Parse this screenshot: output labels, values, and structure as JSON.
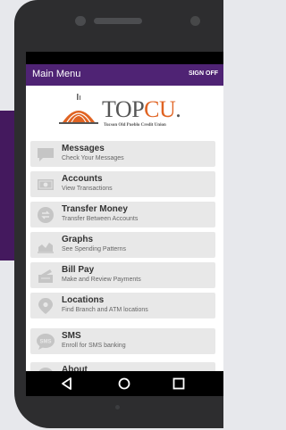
{
  "appbar": {
    "title": "Main Menu",
    "signoff": "SIGN OFF"
  },
  "logo": {
    "name_a": "TOP",
    "name_b": "CU",
    "mark": ".",
    "tagline": "Tucson Old Pueblo Credit Union"
  },
  "menu": [
    {
      "label": "Messages",
      "sub": "Check Your Messages",
      "icon": "chat-bubble-icon"
    },
    {
      "label": "Accounts",
      "sub": "View Transactions",
      "icon": "dollar-bill-icon"
    },
    {
      "label": "Transfer Money",
      "sub": "Transfer Between Accounts",
      "icon": "transfer-arrows-icon"
    },
    {
      "label": "Graphs",
      "sub": "See Spending Patterns",
      "icon": "bar-chart-icon"
    },
    {
      "label": "Bill Pay",
      "sub": "Make and Review Payments",
      "icon": "bill-pay-icon"
    },
    {
      "label": "Locations",
      "sub": "Find Branch and ATM locations",
      "icon": "location-pin-icon"
    },
    {
      "label": "SMS",
      "sub": "Enroll for SMS banking",
      "icon": "sms-bubble-icon",
      "icon_text": "SMS"
    },
    {
      "label": "About",
      "sub": "",
      "icon": "info-icon"
    }
  ],
  "navbar": {
    "back": "back-triangle-icon",
    "home": "home-circle-icon",
    "recents": "recents-square-icon"
  },
  "colors": {
    "appbar": "#4f2374",
    "accent": "#e06322",
    "item_bg": "#e8e8e8",
    "icon": "#c5c5c5"
  }
}
